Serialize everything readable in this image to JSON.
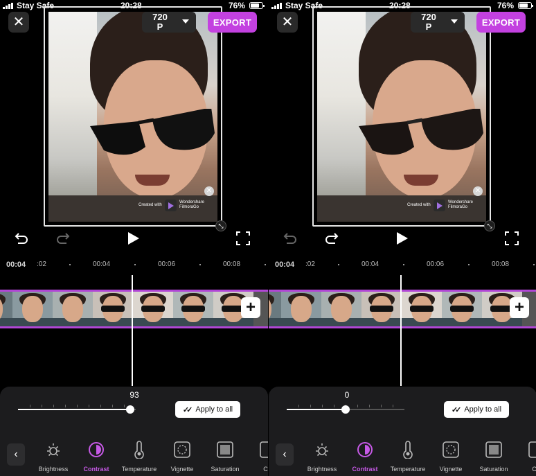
{
  "status_bar": {
    "carrier": "Stay Safe",
    "time": "20:28",
    "battery": "76%"
  },
  "top_bar": {
    "resolution_line1": "720",
    "resolution_line2": "P",
    "export_label": "EXPORT"
  },
  "watermark": {
    "created_with": "Created with",
    "brand_line1": "Wondershare",
    "brand_line2": "FilmoraGo"
  },
  "ruler": {
    "current_time": "00:04",
    "labels": [
      ":02",
      "00:04",
      "00:06",
      "00:08"
    ]
  },
  "colors": {
    "accent": "#c341e0",
    "timeline_border": "#b146d6",
    "panel_bg": "#1c1c1e"
  },
  "screens": [
    {
      "slider_value": "93",
      "slider_fraction": 0.95
    },
    {
      "slider_value": "0",
      "slider_fraction": 0.5
    }
  ],
  "apply_to_all_label": "Apply to all",
  "tools": [
    {
      "label": "Brightness",
      "icon": "brightness-icon",
      "active": false
    },
    {
      "label": "Contrast",
      "icon": "contrast-icon",
      "active": true
    },
    {
      "label": "Temperature",
      "icon": "temperature-icon",
      "active": false
    },
    {
      "label": "Vignette",
      "icon": "vignette-icon",
      "active": false
    },
    {
      "label": "Saturation",
      "icon": "saturation-icon",
      "active": false
    },
    {
      "label": "Cla",
      "icon": "clarity-icon",
      "active": false
    }
  ]
}
